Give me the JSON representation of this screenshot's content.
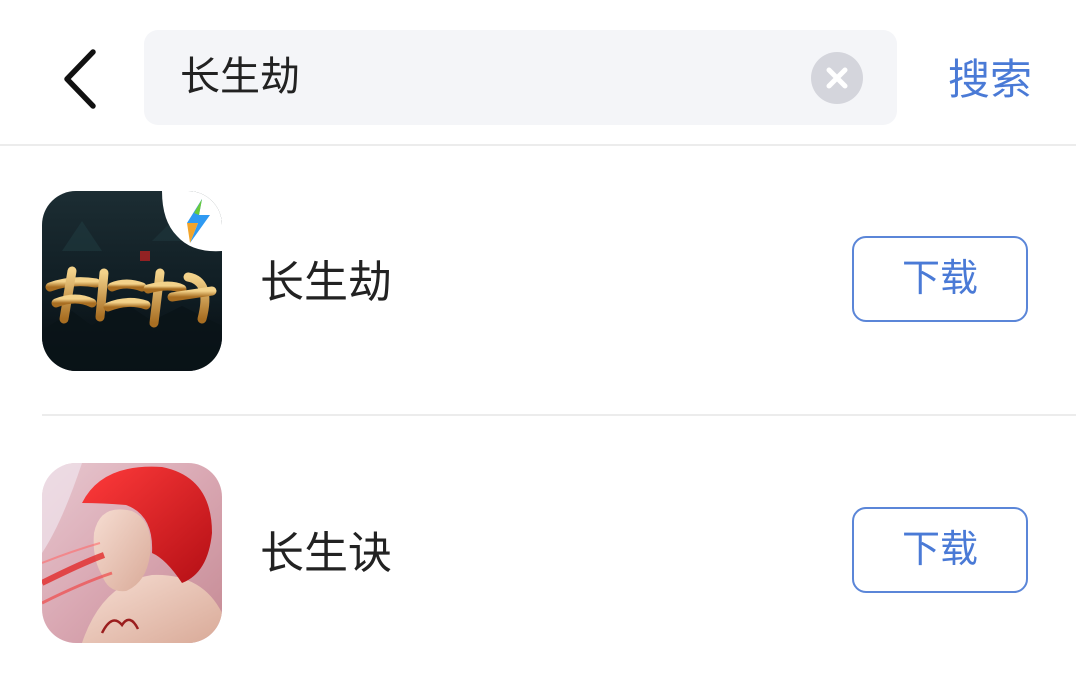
{
  "header": {
    "back_icon": "chevron-left-icon",
    "search": {
      "value": "长生劫",
      "placeholder": ""
    },
    "clear_icon": "close-circle-icon",
    "search_label": "搜索"
  },
  "results": [
    {
      "name": "长生劫",
      "icon": "app-icon-changshengjie",
      "download_label": "下载"
    },
    {
      "name": "长生诀",
      "icon": "app-icon-changshengjue",
      "download_label": "下载"
    }
  ],
  "colors": {
    "accent": "#4a7ad6",
    "search_bg": "#f4f5f8",
    "divider": "#ececec",
    "clear_bg": "#d4d5dc"
  }
}
